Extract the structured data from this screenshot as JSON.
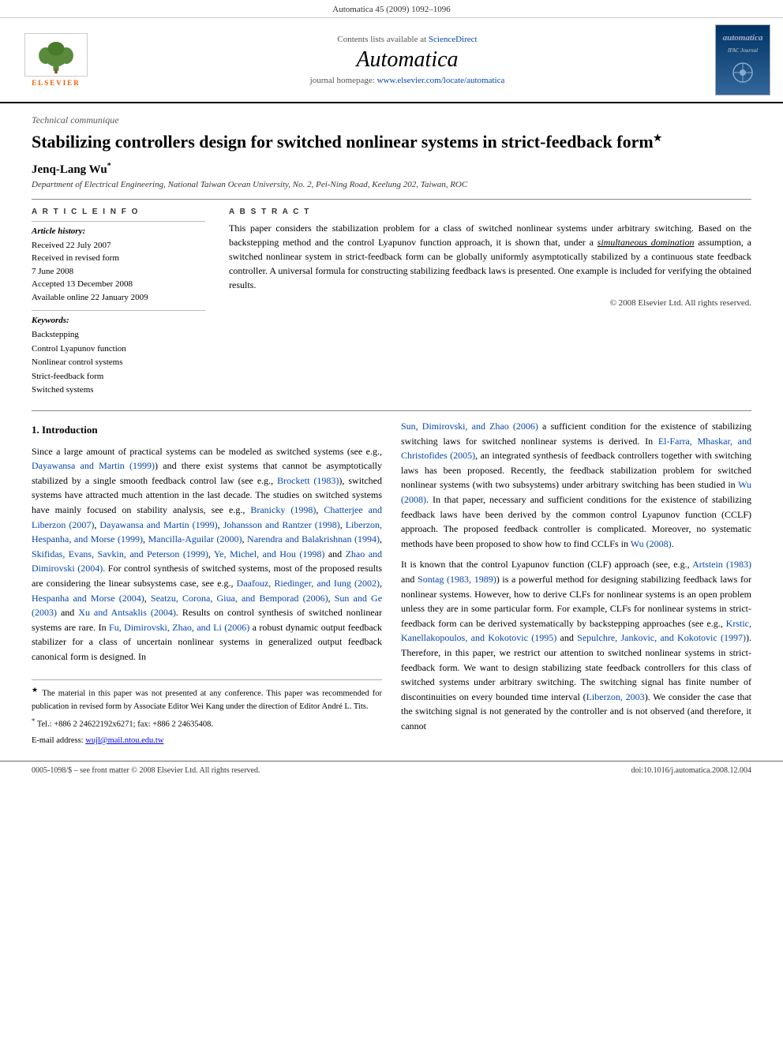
{
  "top_bar": {
    "citation": "Automatica 45 (2009) 1092–1096"
  },
  "journal_header": {
    "contents_available": "Contents lists available at",
    "sciencedirect": "ScienceDirect",
    "journal_title": "Automatica",
    "homepage_label": "journal homepage:",
    "homepage_url": "www.elsevier.com/locate/automatica",
    "elsevier_text": "ELSEVIER"
  },
  "article": {
    "type": "Technical communique",
    "title": "Stabilizing controllers design for switched nonlinear systems in strict-feedback form",
    "title_star": "★",
    "author": "Jenq-Lang Wu",
    "author_star": "*",
    "affiliation": "Department of Electrical Engineering, National Taiwan Ocean University, No. 2, Pei-Ning Road, Keelung 202, Taiwan, ROC"
  },
  "article_info": {
    "section_title": "A R T I C L E   I N F O",
    "history_title": "Article history:",
    "received_label": "Received 22 July 2007",
    "received_revised_label": "Received in revised form",
    "received_revised_date": "7 June 2008",
    "accepted_label": "Accepted 13 December 2008",
    "available_label": "Available online 22 January 2009",
    "keywords_title": "Keywords:",
    "keywords": [
      "Backstepping",
      "Control Lyapunov function",
      "Nonlinear control systems",
      "Strict-feedback form",
      "Switched systems"
    ]
  },
  "abstract": {
    "section_title": "A B S T R A C T",
    "text": "This paper considers the stabilization problem for a class of switched nonlinear systems under arbitrary switching. Based on the backstepping method and the control Lyapunov function approach, it is shown that, under a simultaneous domination assumption, a switched nonlinear system in strict-feedback form can be globally uniformly asymptotically stabilized by a continuous state feedback controller. A universal formula for constructing stabilizing feedback laws is presented. One example is included for verifying the obtained results.",
    "copyright": "© 2008 Elsevier Ltd. All rights reserved."
  },
  "section1": {
    "heading": "1. Introduction",
    "para1": "Since a large amount of practical systems can be modeled as switched systems (see e.g., Dayawansa and Martin (1999)) and there exist systems that cannot be asymptotically stabilized by a single smooth feedback control law (see e.g., Brockett (1983)), switched systems have attracted much attention in the last decade. The studies on switched systems have mainly focused on stability analysis, see e.g., Branicky (1998), Chatterjee and Liberzon (2007), Dayawansa and Martin (1999), Johansson and Rantzer (1998), Liberzon, Hespanha, and Morse (1999), Mancilla-Aguilar (2000), Narendra and Balakrishnan (1994), Skifidas, Evans, Savkin, and Peterson (1999), Ye, Michel, and Hou (1998) and Zhao and Dimirovski (2004). For control synthesis of switched systems, most of the proposed results are considering the linear subsystems case, see e.g., Daafouz, Riedinger, and Iung (2002), Hespanha and Morse (2004), Seatzu, Corona, Giua, and Bemporad (2006), Sun and Ge (2003) and Xu and Antsaklis (2004). Results on control synthesis of switched nonlinear systems are rare. In Fu, Dimirovski, Zhao, and Li (2006) a robust dynamic output feedback stabilizer for a class of uncertain nonlinear systems in generalized output feedback canonical form is designed. In",
    "para2_right": "Sun, Dimirovski, and Zhao (2006) a sufficient condition for the existence of stabilizing switching laws for switched nonlinear systems is derived. In El-Farra, Mhaskar, and Christofides (2005), an integrated synthesis of feedback controllers together with switching laws has been proposed. Recently, the feedback stabilization problem for switched nonlinear systems (with two subsystems) under arbitrary switching has been studied in Wu (2008). In that paper, necessary and sufficient conditions for the existence of stabilizing feedback laws have been derived by the common control Lyapunov function (CCLF) approach. The proposed feedback controller is complicated. Moreover, no systematic methods have been proposed to show how to find CCLFs in Wu (2008).",
    "para3_right": "It is known that the control Lyapunov function (CLF) approach (see, e.g., Artstein (1983) and Sontag (1983, 1989)) is a powerful method for designing stabilizing feedback laws for nonlinear systems. However, how to derive CLFs for nonlinear systems is an open problem unless they are in some particular form. For example, CLFs for nonlinear systems in strict-feedback form can be derived systematically by backstepping approaches (see e.g., Krstic, Kanellakopoulos, and Kokotovic (1995) and Sepulchre, Jankovic, and Kokotovic (1997)). Therefore, in this paper, we restrict our attention to switched nonlinear systems in strict-feedback form. We want to design stabilizing state feedback controllers for this class of switched systems under arbitrary switching. The switching signal has finite number of discontinuities on every bounded time interval (Liberzon, 2003). We consider the case that the switching signal is not generated by the controller and is not observed (and therefore, it cannot"
  },
  "footnotes": {
    "star_note": "The material in this paper was not presented at any conference. This paper was recommended for publication in revised form by Associate Editor Wei Kang under the direction of Editor André L. Tits.",
    "asterisk_note": "Tel.: +886 2 24622192x6271; fax: +886 2 24635408.",
    "email_label": "E-mail address:",
    "email": "wujl@mail.ntou.edu.tw"
  },
  "bottom_bar": {
    "left": "0005-1098/$ – see front matter © 2008 Elsevier Ltd. All rights reserved.",
    "doi": "doi:10.1016/j.automatica.2008.12.004"
  }
}
